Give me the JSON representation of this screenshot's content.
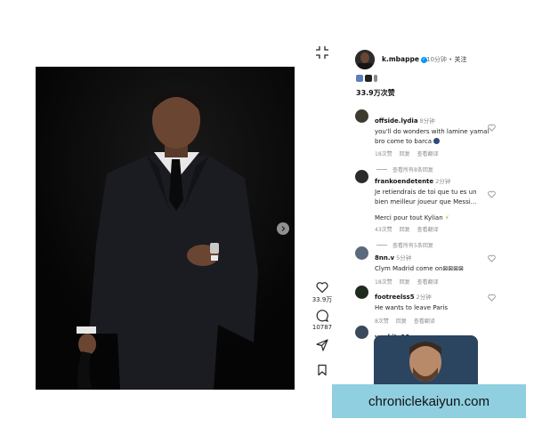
{
  "post": {
    "carousel_next_icon": "chevron-right-icon"
  },
  "actions": {
    "collapse_icon": "minimize-icon",
    "like_count": "33.9万",
    "comment_count": "10787",
    "like_icon": "heart-outline-icon",
    "comment_icon": "comment-bubble-icon",
    "share_icon": "send-icon",
    "save_icon": "bookmark-icon"
  },
  "header": {
    "username": "k.mbappe",
    "time": "10分钟",
    "separator": "•",
    "follow": "关注"
  },
  "post_likes": "33.9万次赞",
  "comments": [
    {
      "user": "offside.lydia",
      "time": "8分钟",
      "text": "you'll do wonders with lamine yamal bro come to barca",
      "likes": "18次赞",
      "reply": "回复",
      "translate": "查看翻译",
      "view_replies": "查看所有8条回复"
    },
    {
      "user": "frankoendetente",
      "time": "2分钟",
      "text": "Je retiendrais de toi que tu es un bien meilleur joueur que Messi...",
      "text2": "Merci pour tout Kylian",
      "likes": "43次赞",
      "reply": "回复",
      "translate": "查看翻译",
      "view_replies": "查看所有5条回复"
    },
    {
      "user": "8nn.v",
      "time": "5分钟",
      "text": "Clym Madrid come on⊠⊠⊠⊠",
      "likes": "18次赞",
      "reply": "回复",
      "translate": "查看翻译"
    },
    {
      "user": "footreelss5",
      "time": "2分钟",
      "text": "He wants to leave Paris",
      "likes": "8次赞",
      "reply": "回复",
      "translate": "查看翻译"
    },
    {
      "user": "yggkjty10"
    }
  ],
  "watermark": "chroniclekaiyun.com",
  "colors": {
    "verified": "#0095f6",
    "watermark_bg": "#8fcfe0",
    "photo_bg": "#060606"
  }
}
